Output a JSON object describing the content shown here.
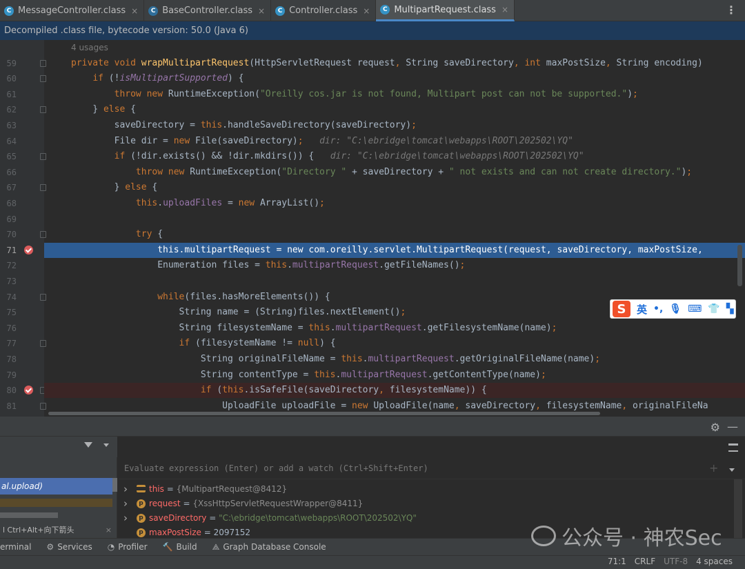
{
  "tabs": [
    {
      "label": "MessageController.class",
      "icon": "class-icon",
      "active": false
    },
    {
      "label": "BaseController.class",
      "icon": "class-icon",
      "active": false
    },
    {
      "label": "Controller.class",
      "icon": "class-icon",
      "active": false
    },
    {
      "label": "MultipartRequest.class",
      "icon": "class-icon",
      "active": true
    }
  ],
  "tab_close_symbol": "×",
  "banner": "Decompiled .class file, bytecode version: 50.0 (Java 6)",
  "editor": {
    "usages": "4 usages",
    "lines": [
      {
        "n": "59",
        "fold": true,
        "bp": false,
        "kind": "",
        "html": "<span class=\"kw\">private void </span><span class=\"fn\">wrapMultipartRequest</span>(HttpServletRequest request<span class=\"kw\">, </span>String saveDirectory<span class=\"kw\">, int </span>maxPostSize<span class=\"kw\">, </span>String encoding)"
      },
      {
        "n": "60",
        "fold": true,
        "bp": false,
        "kind": "",
        "html": "    <span class=\"kw\">if </span>(!<span class=\"itf\">isMultipartSupported</span>) {"
      },
      {
        "n": "61",
        "fold": false,
        "bp": false,
        "kind": "",
        "html": "        <span class=\"kw\">throw new </span>RuntimeException(<span class=\"str\">\"Oreilly cos.jar is not found, Multipart post can not be supported.\"</span>)<span class=\"kw\">;</span>"
      },
      {
        "n": "62",
        "fold": true,
        "bp": false,
        "kind": "",
        "html": "    } <span class=\"kw\">else </span>{"
      },
      {
        "n": "63",
        "fold": false,
        "bp": false,
        "kind": "",
        "html": "        saveDirectory = <span class=\"kw\">this</span>.handleSaveDirectory(saveDirectory)<span class=\"kw\">;</span>"
      },
      {
        "n": "64",
        "fold": false,
        "bp": false,
        "kind": "",
        "html": "        File dir = <span class=\"kw\">new </span>File(saveDirectory)<span class=\"kw\">;   </span><span class=\"hint\">dir: \"C:\\ebridge\\tomcat\\webapps\\ROOT\\202502\\YQ\"</span>"
      },
      {
        "n": "65",
        "fold": true,
        "bp": false,
        "kind": "",
        "html": "        <span class=\"kw\">if </span>(!dir.exists() &amp;&amp; !dir.mkdirs()) {   <span class=\"hint\">dir: \"C:\\ebridge\\tomcat\\webapps\\ROOT\\202502\\YQ\"</span>"
      },
      {
        "n": "66",
        "fold": false,
        "bp": false,
        "kind": "",
        "html": "            <span class=\"kw\">throw new </span>RuntimeException(<span class=\"str\">\"Directory \" </span>+ saveDirectory + <span class=\"str\">\" not exists and can not create directory.\"</span>)<span class=\"kw\">;</span>"
      },
      {
        "n": "67",
        "fold": true,
        "bp": false,
        "kind": "",
        "html": "        } <span class=\"kw\">else </span>{"
      },
      {
        "n": "68",
        "fold": false,
        "bp": false,
        "kind": "",
        "html": "            <span class=\"kw\">this</span>.<span class=\"fld\">uploadFiles </span>= <span class=\"kw\">new </span>ArrayList()<span class=\"kw\">;</span>"
      },
      {
        "n": "69",
        "fold": false,
        "bp": false,
        "kind": "",
        "html": ""
      },
      {
        "n": "70",
        "fold": true,
        "bp": false,
        "kind": "",
        "html": "            <span class=\"kw\">try </span>{"
      },
      {
        "n": "71",
        "fold": false,
        "bp": true,
        "kind": "exec",
        "html": "                <span class=\"kw\">this</span>.<span class=\"fld\">multipartRequest </span>= <span class=\"kw\">new </span>com.oreilly.servlet.MultipartRequest(request<span class=\"kw\">, </span>saveDirectory<span class=\"kw\">, </span>maxPostSize<span class=\"kw\">, </span>"
      },
      {
        "n": "72",
        "fold": false,
        "bp": false,
        "kind": "",
        "html": "                Enumeration files = <span class=\"kw\">this</span>.<span class=\"fld\">multipartRequest</span>.getFileNames()<span class=\"kw\">;</span>"
      },
      {
        "n": "73",
        "fold": false,
        "bp": false,
        "kind": "",
        "html": ""
      },
      {
        "n": "74",
        "fold": true,
        "bp": false,
        "kind": "",
        "html": "                <span class=\"kw\">while</span>(files.hasMoreElements()) {"
      },
      {
        "n": "75",
        "fold": false,
        "bp": false,
        "kind": "",
        "html": "                    String name = (String)files.nextElement()<span class=\"kw\">;</span>"
      },
      {
        "n": "76",
        "fold": false,
        "bp": false,
        "kind": "",
        "html": "                    String filesystemName = <span class=\"kw\">this</span>.<span class=\"fld\">multipartRequest</span>.getFilesystemName(name)<span class=\"kw\">;</span>"
      },
      {
        "n": "77",
        "fold": true,
        "bp": false,
        "kind": "",
        "html": "                    <span class=\"kw\">if </span>(filesystemName != <span class=\"kw\">null</span>) {"
      },
      {
        "n": "78",
        "fold": false,
        "bp": false,
        "kind": "",
        "html": "                        String originalFileName = <span class=\"kw\">this</span>.<span class=\"fld\">multipartRequest</span>.getOriginalFileName(name)<span class=\"kw\">;</span>"
      },
      {
        "n": "79",
        "fold": false,
        "bp": false,
        "kind": "",
        "html": "                        String contentType = <span class=\"kw\">this</span>.<span class=\"fld\">multipartRequest</span>.getContentType(name)<span class=\"kw\">;</span>"
      },
      {
        "n": "80",
        "fold": true,
        "bp": true,
        "kind": "bpl",
        "html": "                        <span class=\"kw\">if </span>(<span class=\"kw\">this</span>.isSafeFile(saveDirectory<span class=\"kw\">, </span>filesystemName)) {"
      },
      {
        "n": "81",
        "fold": true,
        "bp": false,
        "kind": "",
        "html": "                            UploadFile uploadFile = <span class=\"kw\">new </span>UploadFile(name<span class=\"kw\">, </span>saveDirectory<span class=\"kw\">, </span>filesystemName<span class=\"kw\">, </span>originalFileNa"
      }
    ]
  },
  "ime": {
    "logo": "S",
    "lang": "英",
    "icons": [
      "punctuation-icon",
      "microphone-icon",
      "keyboard-icon",
      "skin-icon",
      "toolbox-icon"
    ]
  },
  "debugger": {
    "watch_placeholder": "Evaluate expression (Enter) or add a watch (Ctrl+Shift+Enter)",
    "selected_frame": "al.upload)",
    "frame_hint": "l Ctrl+Alt+向下箭头",
    "variables": [
      {
        "expand": true,
        "icon": "list",
        "name": "this",
        "value": "{MultipartRequest@8412}",
        "vclass": "vobj"
      },
      {
        "expand": true,
        "icon": "p",
        "name": "request",
        "value": "{XssHttpServletRequestWrapper@8411}",
        "vclass": "vobj"
      },
      {
        "expand": true,
        "icon": "p",
        "name": "saveDirectory",
        "value": "\"C:\\ebridge\\tomcat\\webapps\\ROOT\\202502\\YQ\"",
        "vclass": "vstr"
      },
      {
        "expand": false,
        "icon": "p",
        "name": "maxPostSize",
        "value": "2097152",
        "vclass": "vnum"
      }
    ]
  },
  "toolwindows": [
    {
      "label": "erminal",
      "icon": "terminal-icon"
    },
    {
      "label": "Services",
      "icon": "services-icon"
    },
    {
      "label": "Profiler",
      "icon": "profiler-icon"
    },
    {
      "label": "Build",
      "icon": "build-icon"
    },
    {
      "label": "Graph Database Console",
      "icon": "graph-database-icon"
    }
  ],
  "status": {
    "position": "71:1",
    "line_sep": "CRLF",
    "encoding": "UTF-8",
    "indent": "4 spaces"
  },
  "watermark": "公众号 · 神农Sec"
}
